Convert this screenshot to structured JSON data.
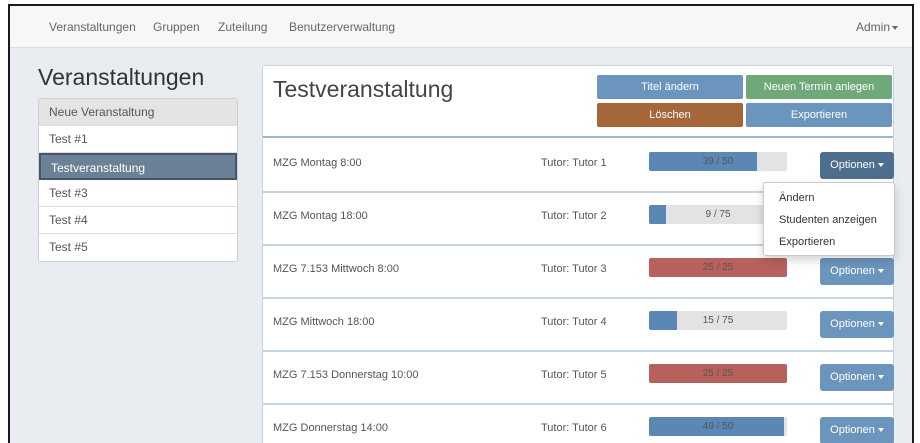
{
  "navbar": {
    "items": [
      "Veranstaltungen",
      "Gruppen",
      "Zuteilung",
      "Benutzerverwaltung"
    ],
    "user": "Admin"
  },
  "sidebar": {
    "title": "Veranstaltungen",
    "items": [
      {
        "label": "Neue Veranstaltung",
        "type": "header"
      },
      {
        "label": "Test #1",
        "type": "normal"
      },
      {
        "label": "Testveranstaltung",
        "type": "active"
      },
      {
        "label": "Test #3",
        "type": "normal"
      },
      {
        "label": "Test #4",
        "type": "normal"
      },
      {
        "label": "Test #5",
        "type": "normal"
      }
    ]
  },
  "main": {
    "title": "Testveranstaltung",
    "buttons": {
      "rename": "Titel ändern",
      "new_date": "Neuen Termin anlegen",
      "delete": "Löschen",
      "export": "Exportieren"
    },
    "rows": [
      {
        "name": "MZG Montag 8:00",
        "tutor": "Tutor: Tutor 1",
        "filled": 39,
        "capacity": 50,
        "progress_text": "39 / 50",
        "status": "normal",
        "options": "Optionen"
      },
      {
        "name": "MZG Montag 18:00",
        "tutor": "Tutor: Tutor 2",
        "filled": 9,
        "capacity": 75,
        "progress_text": "9 / 75",
        "status": "normal",
        "options": "Optionen"
      },
      {
        "name": "MZG 7.153 Mittwoch 8:00",
        "tutor": "Tutor: Tutor 3",
        "filled": 25,
        "capacity": 25,
        "progress_text": "25 / 25",
        "status": "full",
        "options": "Optionen"
      },
      {
        "name": "MZG Mittwoch 18:00",
        "tutor": "Tutor: Tutor 4",
        "filled": 15,
        "capacity": 75,
        "progress_text": "15 / 75",
        "status": "normal",
        "options": "Optionen"
      },
      {
        "name": "MZG 7.153 Donnerstag 10:00",
        "tutor": "Tutor: Tutor 5",
        "filled": 25,
        "capacity": 25,
        "progress_text": "25 / 25",
        "status": "full",
        "options": "Optionen"
      },
      {
        "name": "MZG Donnerstag 14:00",
        "tutor": "Tutor: Tutor 6",
        "filled": 49,
        "capacity": 50,
        "progress_text": "49 / 50",
        "status": "normal",
        "options": "Optionen"
      }
    ],
    "dropdown": {
      "items": [
        "Ändern",
        "Studenten anzeigen",
        "Exportieren"
      ]
    }
  },
  "colors": {
    "progress_normal": "#5b87b5",
    "progress_full": "#b8615c",
    "button_blue": "#6b95bd",
    "button_green": "#6fa97a",
    "button_brown": "#a5663a",
    "active_sidebar": "#6b8196"
  }
}
